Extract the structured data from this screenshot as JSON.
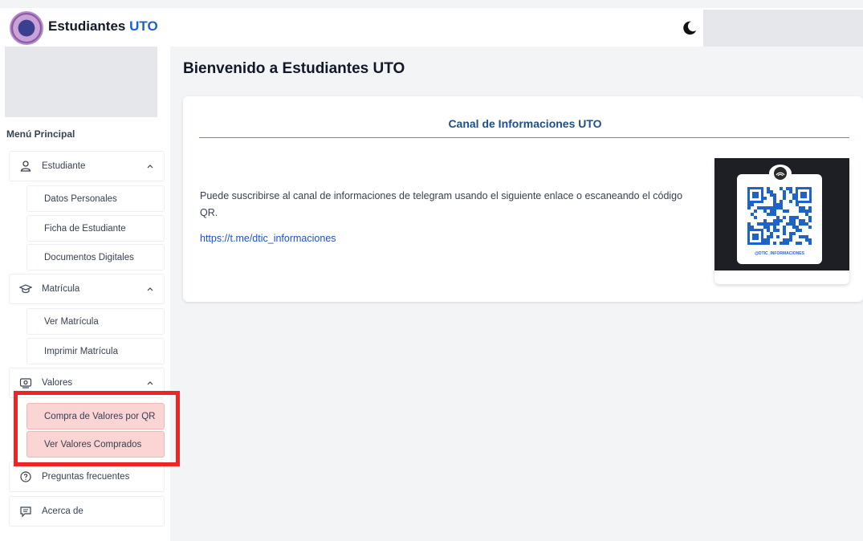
{
  "header": {
    "brand_text": "Estudiantes",
    "brand_accent": "UTO",
    "logo_icon": "university-seal-logo",
    "theme_icon": "moon-icon"
  },
  "sidebar": {
    "menu_title": "Menú Principal",
    "sections": [
      {
        "label": "Estudiante",
        "icon": "user-icon",
        "expanded": true,
        "items": [
          "Datos Personales",
          "Ficha de Estudiante",
          "Documentos Digitales"
        ]
      },
      {
        "label": "Matrícula",
        "icon": "graduation-cap-icon",
        "expanded": true,
        "items": [
          "Ver Matrícula",
          "Imprimir Matrícula"
        ]
      },
      {
        "label": "Valores",
        "icon": "money-icon",
        "expanded": true,
        "items": [
          "Compra de Valores por QR",
          "Ver Valores Comprados"
        ]
      }
    ],
    "faq_label": "Preguntas frecuentes",
    "faq_icon": "question-circle-icon",
    "about_label": "Acerca de",
    "about_icon": "chat-bubble-icon"
  },
  "main": {
    "title": "Bienvenido a Estudiantes UTO",
    "card": {
      "title": "Canal de Informaciones UTO",
      "text": "Puede suscribirse al canal de informaciones de telegram usando el siguiente enlace o escaneando el código QR.",
      "link": "https://t.me/dtic_informaciones",
      "qr_caption": "@DTIC_INFORMACIONES"
    }
  },
  "colors": {
    "accent": "#1f5fcf",
    "link": "#1d4ed8",
    "card_title": "#1e4e8c",
    "highlight_bg": "#fbd4d4",
    "annotation_red": "#ef2525"
  }
}
